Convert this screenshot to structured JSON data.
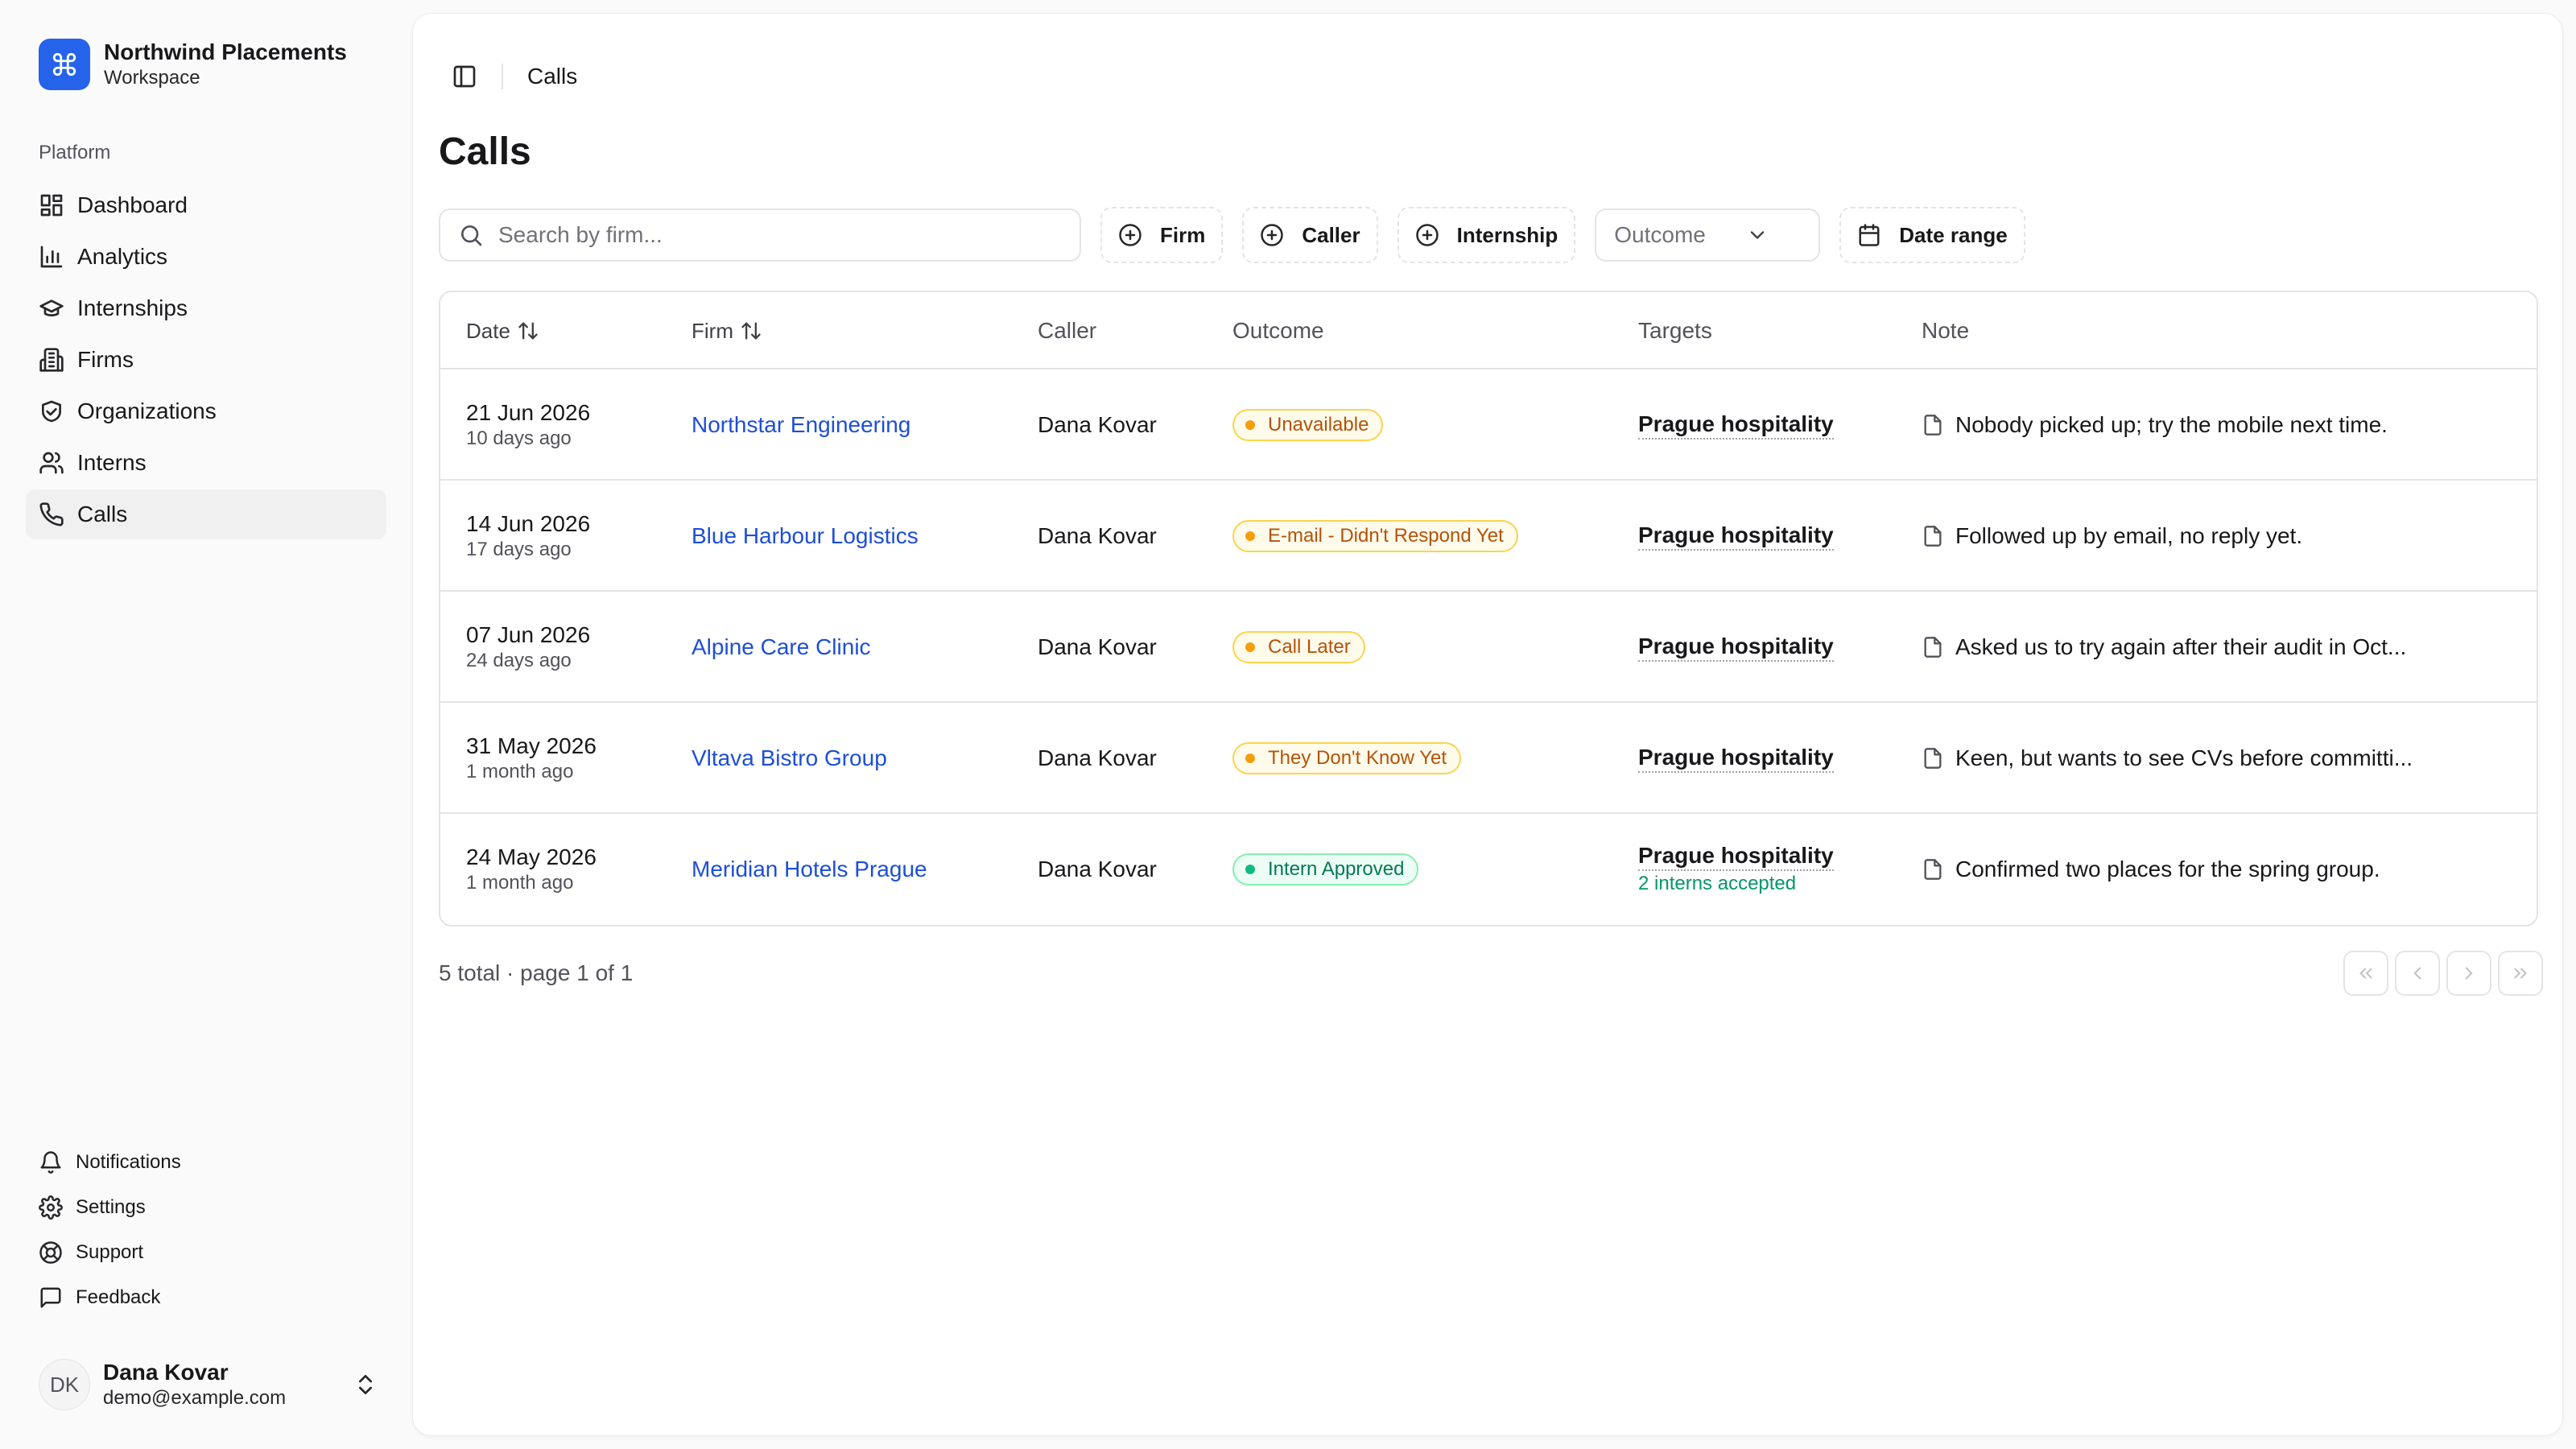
{
  "brand": {
    "name": "Northwind Placements",
    "subtitle": "Workspace",
    "logo_icon": "command-icon",
    "color": "#2563eb"
  },
  "sidebar": {
    "group_label": "Platform",
    "items": [
      {
        "label": "Dashboard",
        "icon": "dashboard-icon"
      },
      {
        "label": "Analytics",
        "icon": "bar-chart-icon"
      },
      {
        "label": "Internships",
        "icon": "graduation-cap-icon"
      },
      {
        "label": "Firms",
        "icon": "building-icon"
      },
      {
        "label": "Organizations",
        "icon": "handshake-icon"
      },
      {
        "label": "Interns",
        "icon": "users-icon"
      },
      {
        "label": "Calls",
        "icon": "phone-icon",
        "active": true
      }
    ],
    "bottom_items": [
      {
        "label": "Notifications",
        "icon": "bell-icon"
      },
      {
        "label": "Settings",
        "icon": "gear-icon"
      },
      {
        "label": "Support",
        "icon": "lifebuoy-icon"
      },
      {
        "label": "Feedback",
        "icon": "message-square-icon"
      }
    ]
  },
  "user": {
    "initials": "DK",
    "name": "Dana Kovar",
    "email": "demo@example.com"
  },
  "header": {
    "breadcrumb": "Calls"
  },
  "page": {
    "title": "Calls"
  },
  "filters": {
    "search_placeholder": "Search by firm...",
    "firm": "Firm",
    "caller": "Caller",
    "internship": "Internship",
    "outcome_placeholder": "Outcome",
    "date_range": "Date range"
  },
  "table": {
    "columns": {
      "date": "Date",
      "firm": "Firm",
      "caller": "Caller",
      "outcome": "Outcome",
      "targets": "Targets",
      "note": "Note"
    },
    "rows": [
      {
        "date": "21 Jun 2026",
        "relative": "10 days ago",
        "firm": "Northstar Engineering",
        "caller": "Dana Kovar",
        "outcome": "Unavailable",
        "tone": "amber",
        "target": "Prague hospitality",
        "target_sub": "",
        "note": "Nobody picked up; try the mobile next time."
      },
      {
        "date": "14 Jun 2026",
        "relative": "17 days ago",
        "firm": "Blue Harbour Logistics",
        "caller": "Dana Kovar",
        "outcome": "E-mail - Didn't Respond Yet",
        "tone": "amber",
        "target": "Prague hospitality",
        "target_sub": "",
        "note": "Followed up by email, no reply yet."
      },
      {
        "date": "07 Jun 2026",
        "relative": "24 days ago",
        "firm": "Alpine Care Clinic",
        "caller": "Dana Kovar",
        "outcome": "Call Later",
        "tone": "amber",
        "target": "Prague hospitality",
        "target_sub": "",
        "note": "Asked us to try again after their audit in Oct..."
      },
      {
        "date": "31 May 2026",
        "relative": "1 month ago",
        "firm": "Vltava Bistro Group",
        "caller": "Dana Kovar",
        "outcome": "They Don't Know Yet",
        "tone": "amber",
        "target": "Prague hospitality",
        "target_sub": "",
        "note": "Keen, but wants to see CVs before committi..."
      },
      {
        "date": "24 May 2026",
        "relative": "1 month ago",
        "firm": "Meridian Hotels Prague",
        "caller": "Dana Kovar",
        "outcome": "Intern Approved",
        "tone": "green",
        "target": "Prague hospitality",
        "target_sub": "2 interns accepted",
        "note": "Confirmed two places for the spring group."
      }
    ]
  },
  "footer": {
    "summary": "5 total · page 1 of 1"
  },
  "colors": {
    "link": "#1d4ed8",
    "amber": "#b45309",
    "green": "#047857"
  }
}
